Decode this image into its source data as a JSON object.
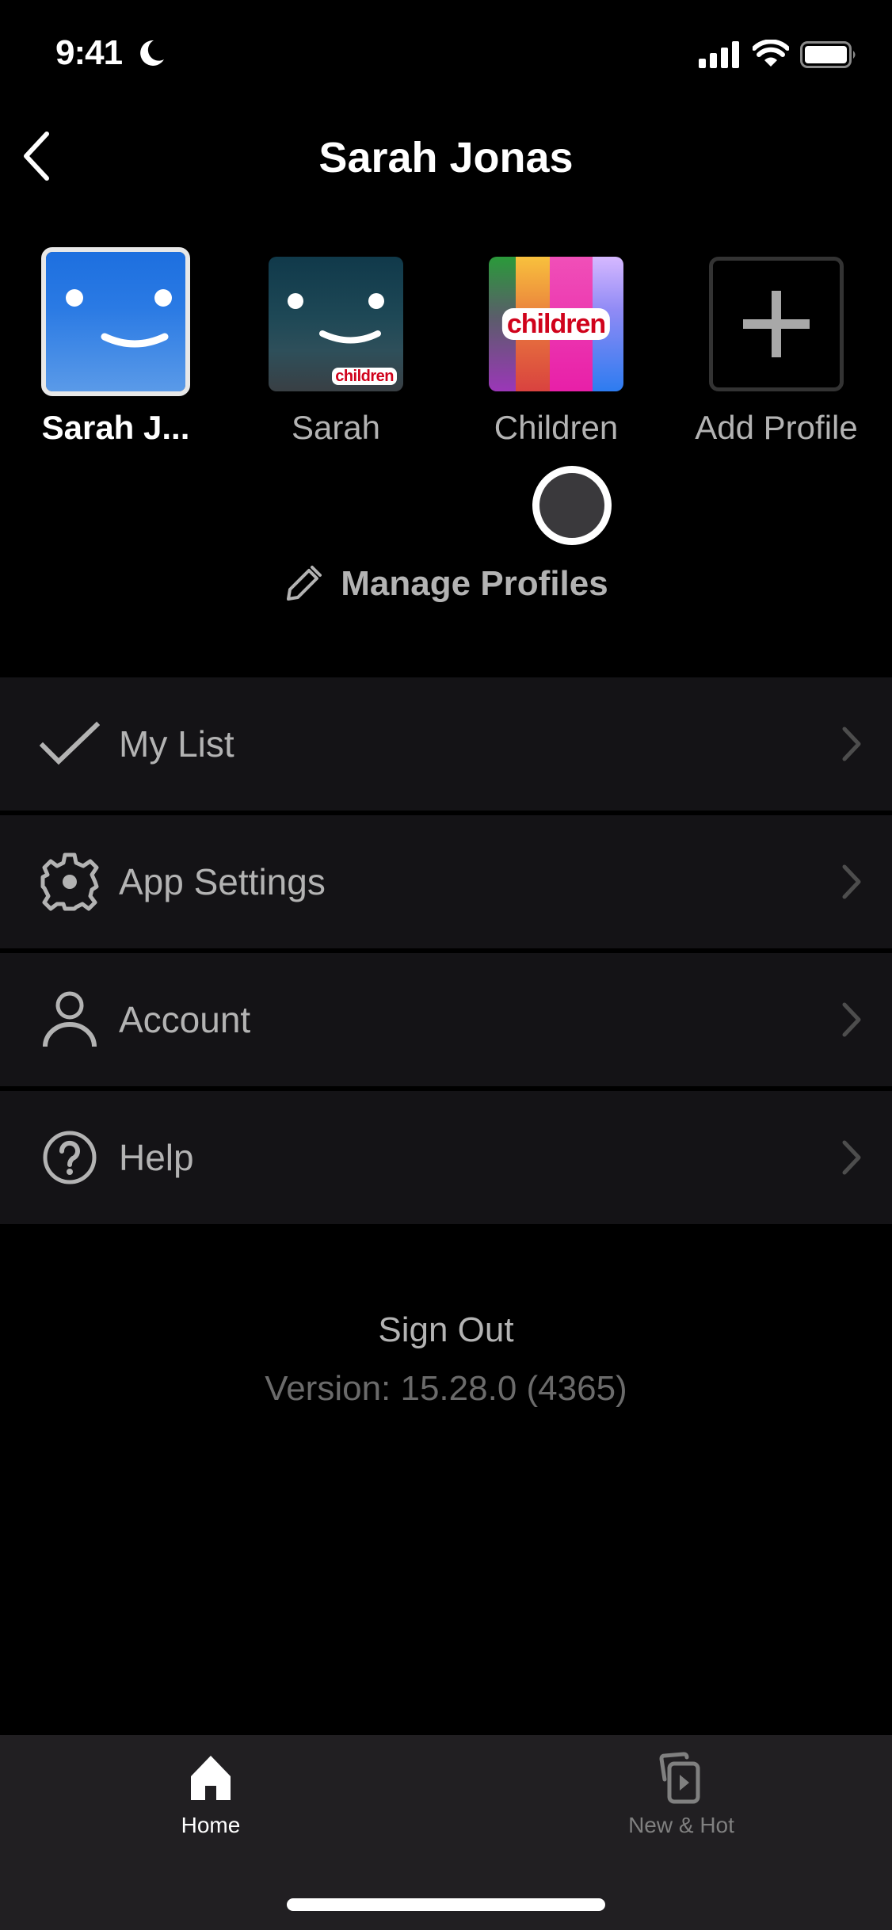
{
  "status_bar": {
    "time": "9:41",
    "icons": [
      "moon-icon",
      "signal-icon",
      "wifi-icon",
      "battery-icon"
    ]
  },
  "header": {
    "title": "Sarah Jonas",
    "back_icon": "chevron-left-icon"
  },
  "profiles": [
    {
      "name": "Sarah J...",
      "avatar": "blue-smiley",
      "active": true
    },
    {
      "name": "Sarah",
      "avatar": "teal-smiley-kids",
      "badge": "children",
      "active": false
    },
    {
      "name": "Children",
      "avatar": "kids-stripes",
      "badge": "children",
      "active": false
    },
    {
      "name": "Add Profile",
      "avatar": "plus-icon",
      "active": false
    }
  ],
  "manage_profiles": {
    "label": "Manage Profiles",
    "icon": "pencil-icon"
  },
  "menu": {
    "items": [
      {
        "label": "My List",
        "icon": "checkmark-icon"
      },
      {
        "label": "App Settings",
        "icon": "gear-icon"
      },
      {
        "label": "Account",
        "icon": "person-icon"
      },
      {
        "label": "Help",
        "icon": "question-circle-icon"
      }
    ]
  },
  "footer": {
    "sign_out": "Sign Out",
    "version": "Version: 15.28.0 (4365)"
  },
  "tab_bar": {
    "tabs": [
      {
        "label": "Home",
        "icon": "home-icon",
        "active": true
      },
      {
        "label": "New & Hot",
        "icon": "new-hot-icon",
        "active": false
      }
    ]
  },
  "colors": {
    "background": "#000000",
    "row_background": "#141316",
    "tab_bar_background": "#211f22",
    "text_primary": "#ffffff",
    "text_secondary": "#b3b3b3",
    "text_muted": "#6b6b6b",
    "kids_red": "#d0021b",
    "profile_blue": "#2a7ae4"
  }
}
